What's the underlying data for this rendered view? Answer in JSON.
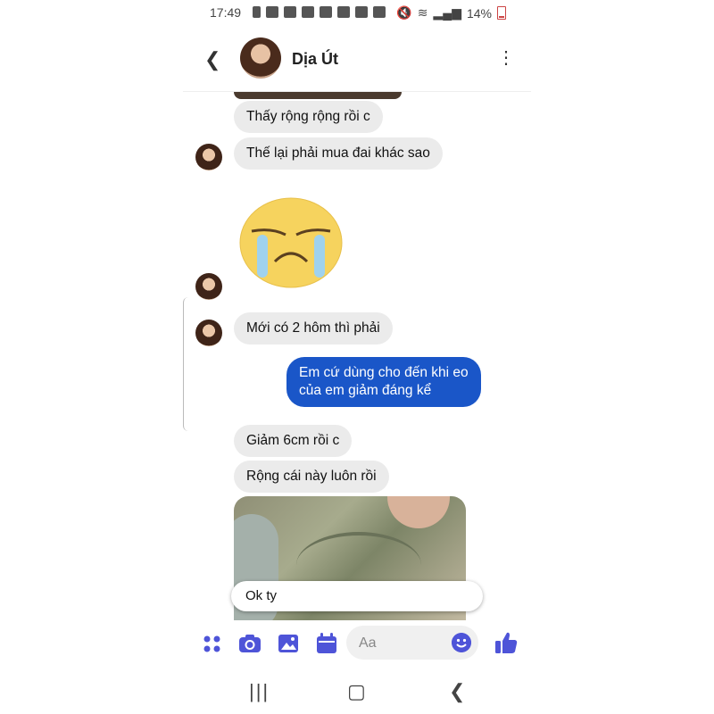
{
  "status_bar": {
    "time": "17:49",
    "battery": "14%"
  },
  "header": {
    "contact_name": "Dịa Út"
  },
  "messages": [
    {
      "text": "Thấy rộng rộng rồi c"
    },
    {
      "text": "Thế lại phải mua đai khác sao"
    },
    {
      "text": "Mới có 2 hôm thì phải"
    },
    {
      "text": "Em cứ dùng cho đến khi eo của em giảm đáng kể"
    },
    {
      "text": "Giảm 6cm rồi c"
    },
    {
      "text": "Rộng cái này luôn rồi"
    }
  ],
  "suggestion": {
    "text": "Ok ty"
  },
  "composer": {
    "placeholder": "Aa"
  },
  "colors": {
    "accent": "#4e54d8",
    "my_bubble": "#1a56c8",
    "their_bubble": "#ebebeb"
  }
}
